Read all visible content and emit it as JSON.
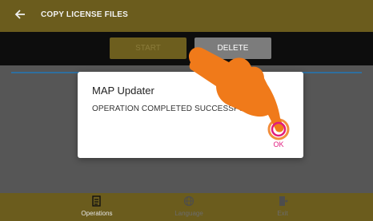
{
  "header": {
    "title": "COPY LICENSE FILES",
    "back_icon": "arrow-left-icon"
  },
  "toolbar": {
    "start_label": "START",
    "delete_label": "DELETE"
  },
  "dialog": {
    "title": "MAP Updater",
    "message": "OPERATION COMPLETED SUCCESSFULLY",
    "ok_label": "OK"
  },
  "bottom_nav": {
    "items": [
      {
        "label": "Operations",
        "icon": "document-icon"
      },
      {
        "label": "Language",
        "icon": "globe-icon"
      },
      {
        "label": "Exit",
        "icon": "exit-door-icon"
      }
    ]
  },
  "colors": {
    "title_bar": "#6b5c1d",
    "toolbar": "#0d0d0d",
    "accent_ok": "#e11b7d",
    "hand": "#f07a1a"
  }
}
